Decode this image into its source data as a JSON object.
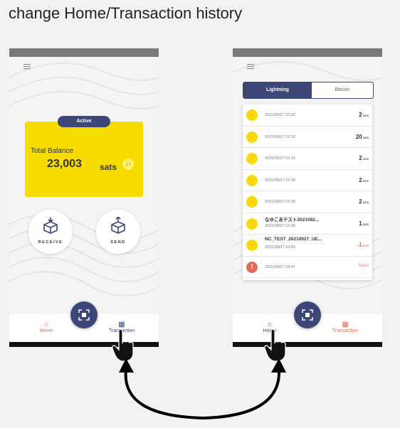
{
  "heading": "change Home/Transaction history",
  "home": {
    "status_badge": "Active",
    "total_balance_label": "Total Balance",
    "total_balance_amount": "23,003",
    "unit": "sats",
    "swap_icon": "swap-arrows-icon",
    "receive_label": "RECEIVE",
    "send_label": "SEND"
  },
  "nav": {
    "home_label": "Home",
    "transaction_label": "Transaction"
  },
  "transaction": {
    "tabs": [
      "Lightning",
      "Bitcoin"
    ],
    "active_tab": "Lightning",
    "rows": [
      {
        "title": "",
        "date": "2021/09/27 22:52",
        "amount": "2",
        "unit": "sats",
        "icon": "lightning-icon",
        "style": "normal"
      },
      {
        "title": "",
        "date": "2021/09/27 22:32",
        "amount": "20",
        "unit": "sats",
        "icon": "lightning-icon",
        "style": "normal"
      },
      {
        "title": "",
        "date": "2021/09/27 22:31",
        "amount": "2",
        "unit": "sats",
        "icon": "lightning-icon",
        "style": "normal"
      },
      {
        "title": "",
        "date": "2021/09/27 22:30",
        "amount": "2",
        "unit": "sats",
        "icon": "lightning-icon",
        "style": "normal"
      },
      {
        "title": "",
        "date": "2021/09/27 22:29",
        "amount": "2",
        "unit": "sats",
        "icon": "lightning-icon",
        "style": "normal"
      },
      {
        "title": "なゆこあテスト2021092...",
        "date": "2021/09/27 22:06",
        "amount": "1",
        "unit": "sats",
        "icon": "lightning-icon",
        "style": "normal"
      },
      {
        "title": "NC_TEST_20210927_UE...",
        "date": "2021/09/27 19:55",
        "amount": "-1",
        "unit": "sats",
        "icon": "lightning-icon",
        "style": "neg"
      },
      {
        "title": "",
        "date": "2021/09/27 19:47",
        "amount": "failed",
        "unit": "",
        "icon": "error-icon",
        "style": "fail"
      }
    ]
  },
  "colors": {
    "accent_navy": "#3d4777",
    "card_yellow": "#f7dc00",
    "nav_red": "#e06a5a"
  }
}
